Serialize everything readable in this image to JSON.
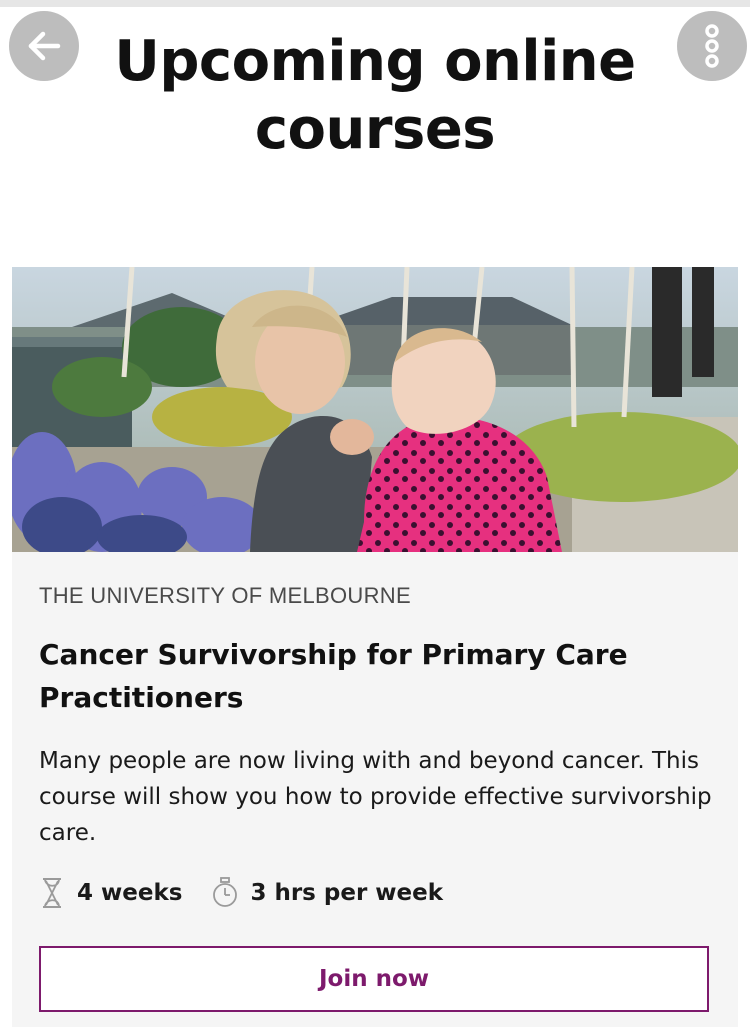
{
  "header": {
    "title": "Upcoming online courses",
    "back_icon": "arrow-left-icon",
    "more_icon": "more-options-icon"
  },
  "course": {
    "image_icon": "course-photo",
    "provider": "THE UNIVERSITY OF MELBOURNE",
    "title": "Cancer Survivorship for Primary Care Practitioners",
    "description": "Many people are now living with and beyond cancer. This course will show you how to provide effective survivorship care.",
    "duration": "4 weeks",
    "effort": "3 hrs per week",
    "duration_icon": "hourglass-icon",
    "effort_icon": "stopwatch-icon",
    "cta_label": "Join now"
  },
  "colors": {
    "accent": "#7d1a6c",
    "icon_button_bg": "#bdbdbd",
    "card_bg": "#f5f5f5"
  }
}
